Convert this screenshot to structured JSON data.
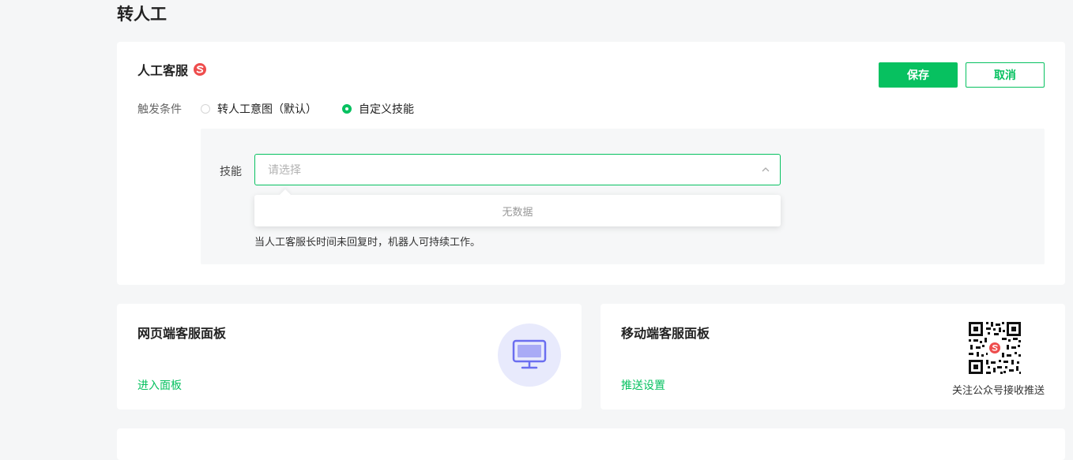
{
  "page": {
    "title": "转人工"
  },
  "main_card": {
    "title": "人工客服",
    "logo_icon": "sogou-logo-icon",
    "save_label": "保存",
    "cancel_label": "取消",
    "trigger": {
      "label": "触发条件",
      "options": [
        {
          "label": "转人工意图（默认）",
          "checked": false
        },
        {
          "label": "自定义技能",
          "checked": true
        }
      ]
    },
    "skill": {
      "label": "技能",
      "placeholder": "请选择",
      "dropdown_empty": "无数据"
    },
    "hint": "当人工客服长时间未回复时，机器人可持续工作。"
  },
  "web_panel": {
    "title": "网页端客服面板",
    "link": "进入面板",
    "icon": "monitor-icon"
  },
  "mobile_panel": {
    "title": "移动端客服面板",
    "link": "推送设置",
    "qr_caption": "关注公众号接收推送",
    "icon": "qr-code-icon"
  },
  "colors": {
    "accent": "#07c160",
    "background": "#f5f6f7",
    "panel_bg": "#f6f7f8",
    "logo_red": "#ee4d4d",
    "monitor_purple": "#6b6ef0"
  }
}
